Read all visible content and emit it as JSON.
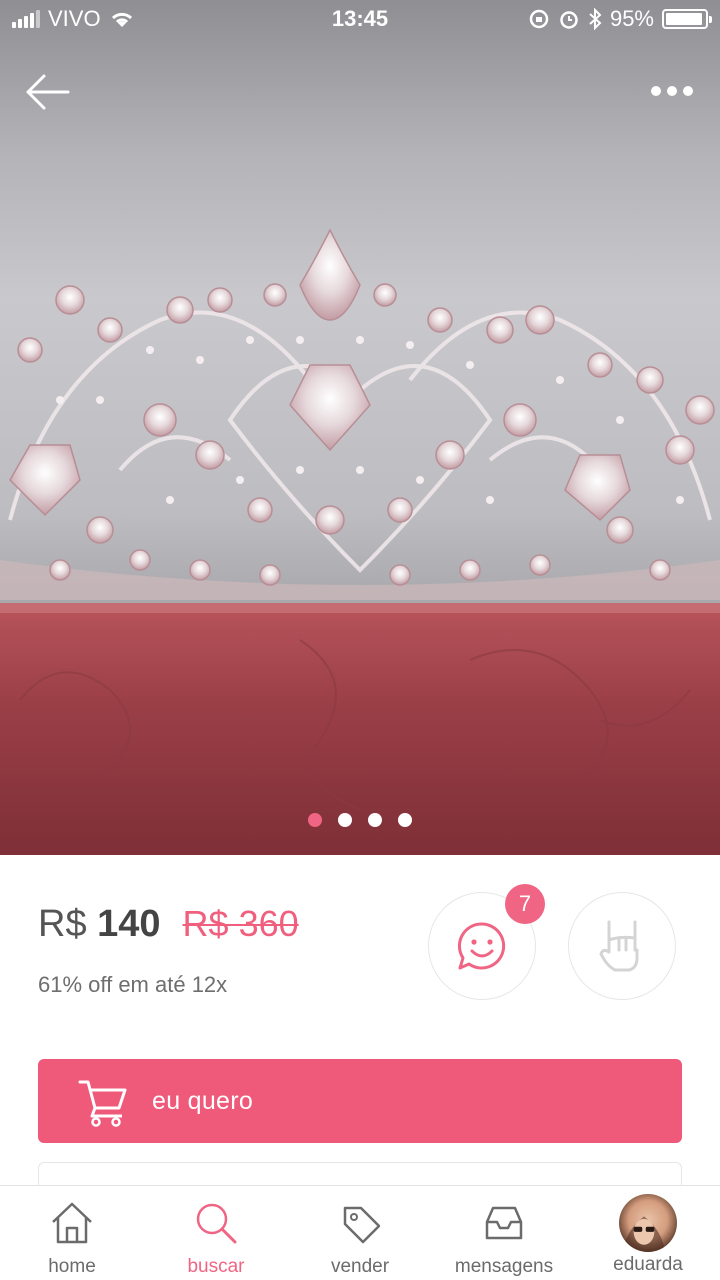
{
  "status_bar": {
    "carrier": "VIVO",
    "time": "13:45",
    "battery": "95%",
    "battery_level": 0.95
  },
  "product": {
    "price_prefix": "R$",
    "price_value": "140",
    "old_price": "R$ 360",
    "installments": "61% off em até 12x",
    "comment_count": "7",
    "buy_label": "eu quero",
    "image_count": 4,
    "active_image": 1
  },
  "tabs": [
    {
      "label": "home",
      "icon": "home-icon"
    },
    {
      "label": "buscar",
      "icon": "search-icon",
      "active": true
    },
    {
      "label": "vender",
      "icon": "tag-icon"
    },
    {
      "label": "mensagens",
      "icon": "inbox-icon"
    },
    {
      "label": "eduarda",
      "icon": "avatar"
    }
  ],
  "colors": {
    "accent": "#f06584",
    "buy_button": "#f05a7a"
  }
}
